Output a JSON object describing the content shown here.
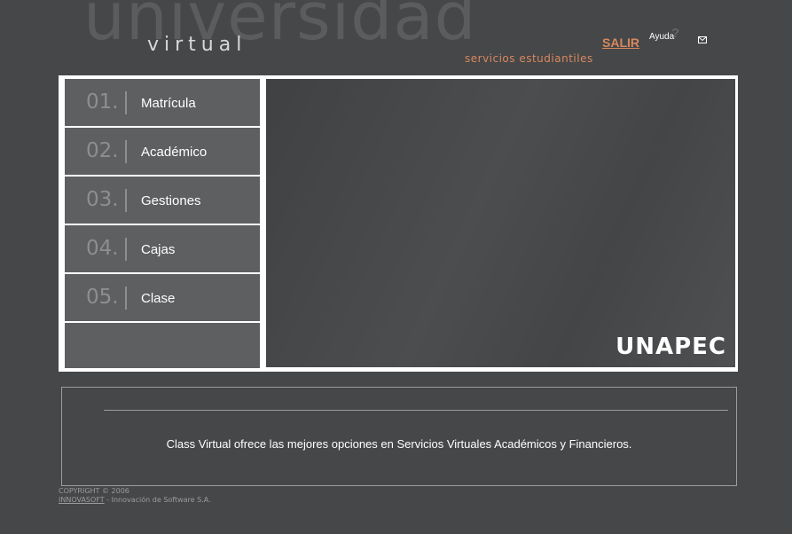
{
  "header": {
    "big_word": "universidad",
    "small_word": "virtual",
    "subtitle": "servicios estudiantiles",
    "salir_label": "SALIR",
    "ayuda_label": "Ayuda",
    "ayuda_mark": "?"
  },
  "menu": {
    "items": [
      {
        "number": "01.",
        "label": "Matrícula"
      },
      {
        "number": "02.",
        "label": "Académico"
      },
      {
        "number": "03.",
        "label": "Gestiones"
      },
      {
        "number": "04.",
        "label": "Cajas"
      },
      {
        "number": "05.",
        "label": "Clase"
      }
    ]
  },
  "hero": {
    "logo_text": "UNAPEC"
  },
  "info": {
    "text": "Class Virtual ofrece las mejores opciones en Servicios Virtuales Académicos y Financieros."
  },
  "footer": {
    "copyright": "COPYRIGHT © 2006",
    "company": "INNOVASOFT",
    "company_suffix": " - Innovación de Software S.A."
  },
  "colors": {
    "background": "#454749",
    "accent": "#d9885e",
    "menu_item": "#5d5f61"
  },
  "icons": {
    "mail": "mail-icon"
  }
}
